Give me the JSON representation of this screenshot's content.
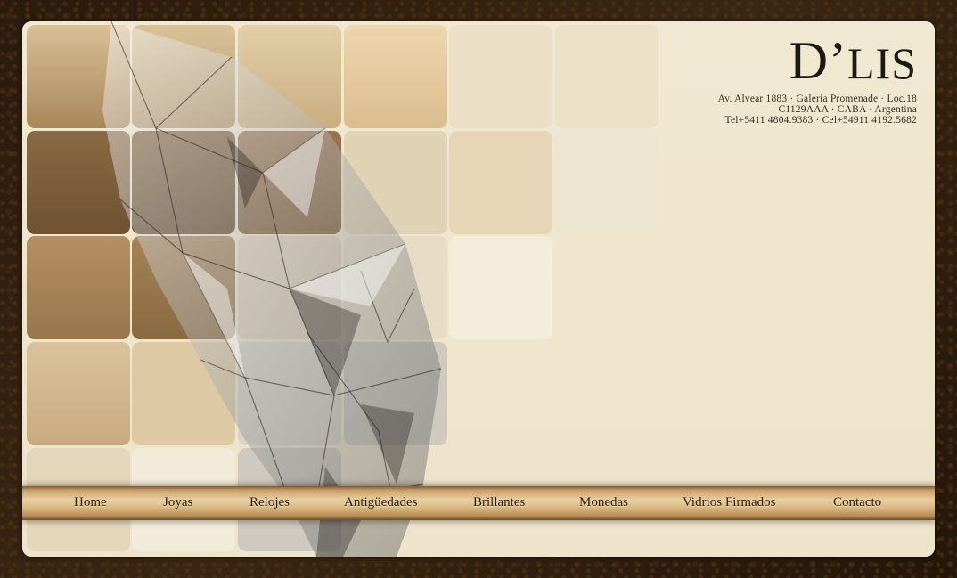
{
  "brand": {
    "logo_main": "D’",
    "logo_rest": "LIS",
    "address_line1": "Av. Alvear 1883 · Galería Promenade · Loc.18",
    "address_line2": "C1129AAA · CABA · Argentina",
    "address_line3": "Tel+5411 4804.9383 · Cel+54911 4192.5682"
  },
  "nav": {
    "items": [
      "Home",
      "Joyas",
      "Relojes",
      "Antigüedades",
      "Brillantes",
      "Monedas",
      "Vidrios Firmados",
      "Contacto"
    ]
  },
  "colors": {
    "background": "#2a1a0e",
    "panel": "#efe5cc",
    "nav_gold": "#d9b680"
  },
  "icons": {
    "hero": "diamond-image"
  }
}
